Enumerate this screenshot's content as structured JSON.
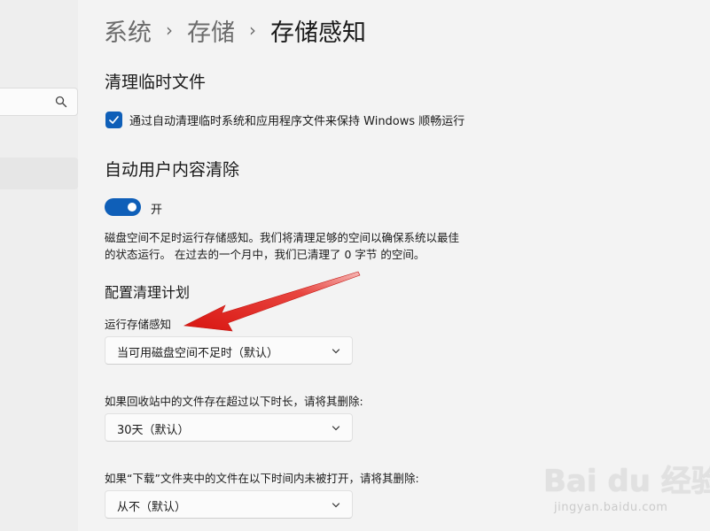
{
  "breadcrumb": {
    "items": [
      "系统",
      "存储",
      "存储感知"
    ]
  },
  "temp_files": {
    "title": "清理临时文件",
    "checkbox_label": "通过自动清理临时系统和应用程序文件来保持 Windows 顺畅运行",
    "checked": true
  },
  "auto_clean": {
    "title": "自动用户内容清除",
    "toggle_label": "开",
    "toggle_on": true,
    "description_line1": "磁盘空间不足时运行存储感知。我们将清理足够的空间以确保系统以最佳",
    "description_line2": "的状态运行。 在过去的一个月中，我们已清理了 0 字节 的空间。"
  },
  "schedule": {
    "title": "配置清理计划",
    "run_label": "运行存储感知",
    "run_value": "当可用磁盘空间不足时（默认）",
    "recycle_label": "如果回收站中的文件存在超过以下时长，请将其删除:",
    "recycle_value": "30天（默认）",
    "downloads_label": "如果“下载”文件夹中的文件在以下时间内未被打开，请将其删除:",
    "downloads_value": "从不（默认）"
  },
  "watermark": {
    "logo": "Bai du 经验",
    "url": "jingyan.baidu.com"
  },
  "colors": {
    "accent": "#0f5fb8",
    "annotation_arrow": "#e0201b",
    "background": "#f3f3f3"
  },
  "icons": {
    "search": "search-icon",
    "dropdown": "chevron-down-icon",
    "check": "check-icon"
  }
}
